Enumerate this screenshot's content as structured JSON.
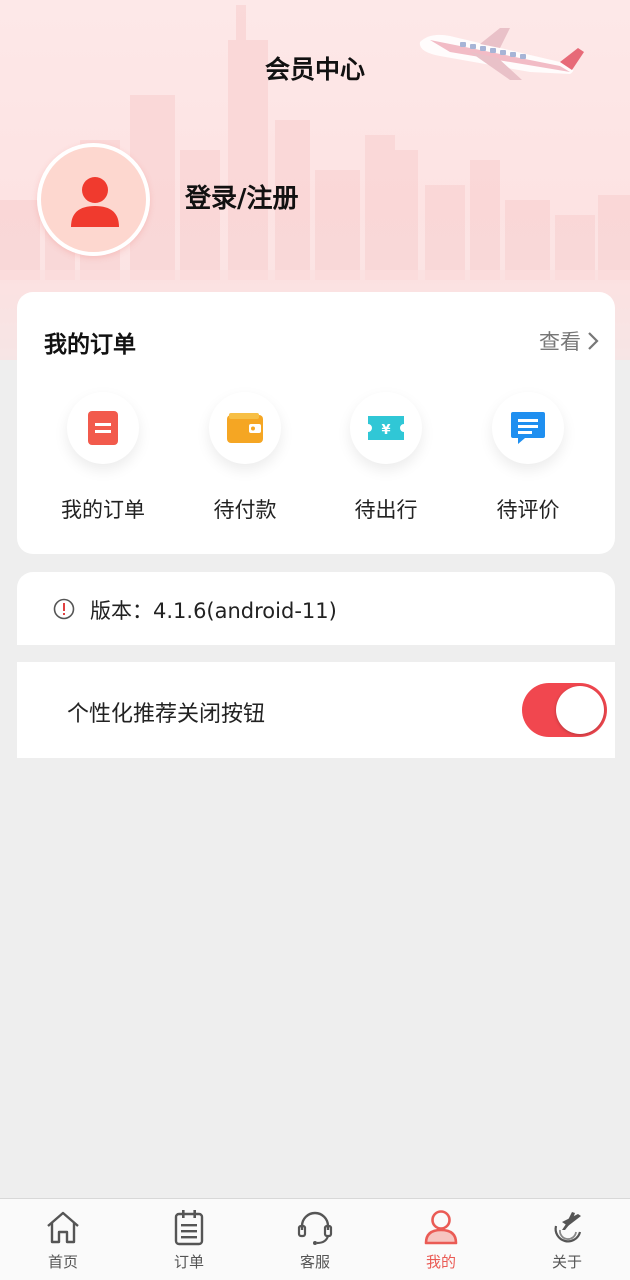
{
  "header": {
    "title": "会员中心",
    "login_label": "登录/注册"
  },
  "orders": {
    "title": "我的订单",
    "view_label": "查看",
    "items": [
      {
        "label": "我的订单",
        "icon": "order-list-icon",
        "color": "#f25a4c"
      },
      {
        "label": "待付款",
        "icon": "wallet-icon",
        "color": "#f5a623"
      },
      {
        "label": "待出行",
        "icon": "ticket-icon",
        "color": "#30c7d6"
      },
      {
        "label": "待评价",
        "icon": "comment-icon",
        "color": "#1f8ff0"
      }
    ]
  },
  "version": {
    "text": "版本：4.1.6(android-11)",
    "icon": "info-icon"
  },
  "personalization": {
    "label": "个性化推荐关闭按钮",
    "enabled": true,
    "accent": "#f1474f"
  },
  "tabbar": {
    "active": "我的",
    "items": [
      {
        "label": "首页",
        "icon": "home-icon"
      },
      {
        "label": "订单",
        "icon": "clipboard-icon"
      },
      {
        "label": "客服",
        "icon": "headset-icon"
      },
      {
        "label": "我的",
        "icon": "user-icon"
      },
      {
        "label": "关于",
        "icon": "plane-logo-icon"
      }
    ]
  }
}
